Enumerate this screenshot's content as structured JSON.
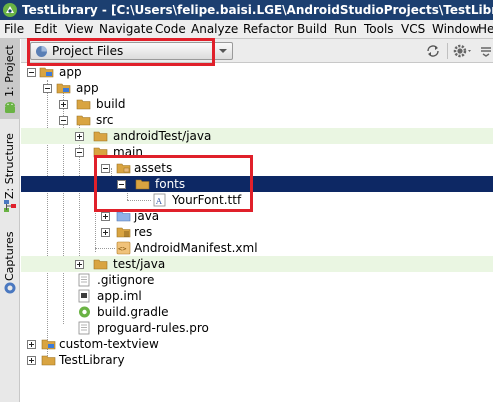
{
  "window": {
    "title": "TestLibrary - [C:\\Users\\felipe.baisi.LGE\\AndroidStudioProjects\\TestLibrary] - [app]"
  },
  "menu": [
    "File",
    "Edit",
    "View",
    "Navigate",
    "Code",
    "Analyze",
    "Refactor",
    "Build",
    "Run",
    "Tools",
    "VCS",
    "Window",
    "He"
  ],
  "left_strip": {
    "tabs": [
      "1: Project",
      "Z: Structure",
      "Captures"
    ]
  },
  "panel": {
    "view_selector": "Project Files"
  },
  "tree": [
    {
      "label": "app"
    },
    {
      "label": "app"
    },
    {
      "label": "build"
    },
    {
      "label": "src"
    },
    {
      "label": "androidTest/java"
    },
    {
      "label": "main"
    },
    {
      "label": "assets"
    },
    {
      "label": "fonts"
    },
    {
      "label": "YourFont.ttf"
    },
    {
      "label": "java"
    },
    {
      "label": "res"
    },
    {
      "label": "AndroidManifest.xml"
    },
    {
      "label": "test/java"
    },
    {
      "label": ".gitignore"
    },
    {
      "label": "app.iml"
    },
    {
      "label": "build.gradle"
    },
    {
      "label": "proguard-rules.pro"
    },
    {
      "label": "custom-textview"
    },
    {
      "label": "TestLibrary"
    }
  ],
  "colors": {
    "title_bg": "#1c3f70",
    "selection_bg": "#0d2864",
    "highlight_border": "#e0202a",
    "folder": "#d9a441",
    "test_folder_row": "#eaf6e2"
  }
}
